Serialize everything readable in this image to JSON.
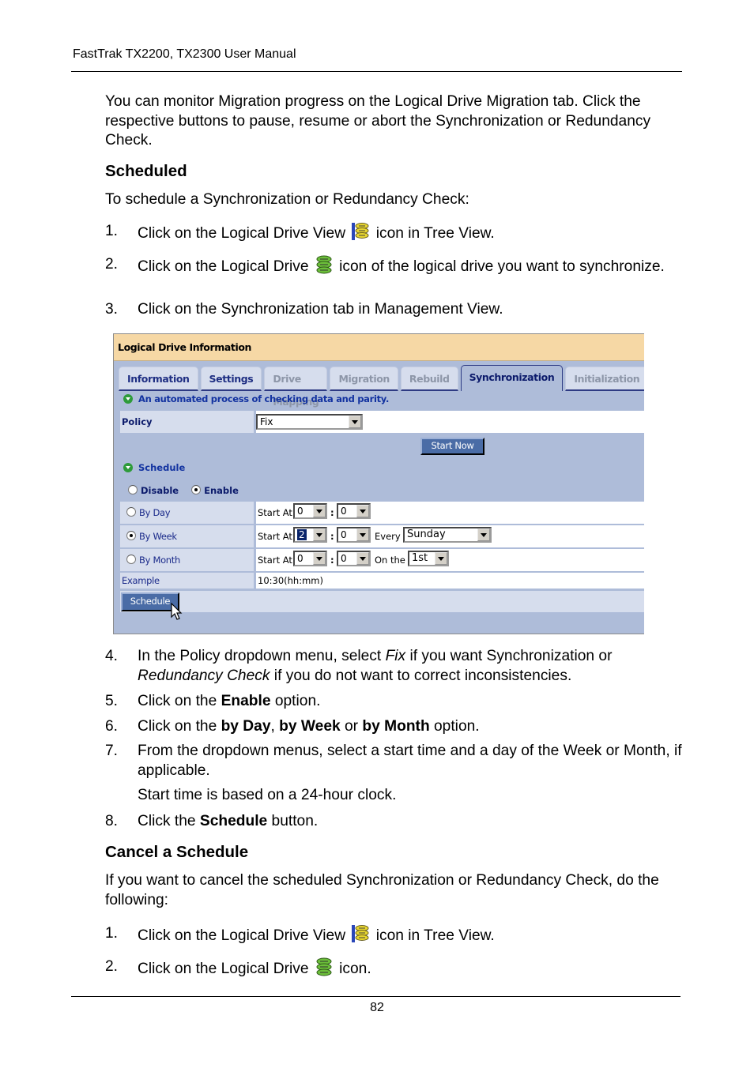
{
  "header": {
    "title": "FastTrak TX2200, TX2300 User Manual"
  },
  "intro": "You can monitor Migration progress on the Logical Drive Migration tab. Click the respective buttons to pause, resume or abort the Synchronization or Redundancy Check.",
  "scheduled": {
    "heading": "Scheduled",
    "lead": "To schedule a Synchronization or Redundancy Check:",
    "steps": [
      {
        "num": "1.",
        "before": "Click on the Logical Drive View",
        "icon": "logical-drive-view-icon",
        "after": "icon in Tree View."
      },
      {
        "num": "2.",
        "before": "Click on the Logical Drive",
        "icon": "logical-drive-icon",
        "after": "icon of the logical drive you want to synchronize."
      },
      {
        "num": "3.",
        "text": "Click on the Synchronization tab in Management View."
      }
    ],
    "steps_after": [
      {
        "num": "4.",
        "p1": "In the Policy dropdown menu, select ",
        "i1": "Fix",
        "p2": " if you want Synchronization or ",
        "i2": "Redundancy Check",
        "p3": " if you do not want to correct inconsistencies."
      },
      {
        "num": "5.",
        "p1": "Click on the ",
        "b1": "Enable",
        "p2": " option."
      },
      {
        "num": "6.",
        "p1": "Click on the ",
        "b1": "by Day",
        "p2": ", ",
        "b2": "by Week",
        "p3": " or ",
        "b3": "by Month",
        "p4": " option."
      },
      {
        "num": "7.",
        "text": "From the dropdown menus, select a start time and a day of the Week or Month, if applicable.",
        "note": "Start time is based on a 24-hour clock."
      },
      {
        "num": "8.",
        "p1": "Click the ",
        "b1": "Schedule",
        "p2": " button."
      }
    ]
  },
  "cancel": {
    "heading": "Cancel a Schedule",
    "lead": "If you want to cancel the scheduled Synchronization or Redundancy Check, do the following:",
    "steps": [
      {
        "num": "1.",
        "before": "Click on the Logical Drive View",
        "icon": "logical-drive-view-icon",
        "after": "icon in Tree View."
      },
      {
        "num": "2.",
        "before": "Click on the Logical Drive",
        "icon": "logical-drive-icon",
        "after": "icon."
      }
    ]
  },
  "screenshot": {
    "panel_title": "Logical Drive Information",
    "tabs": [
      {
        "label": "Information",
        "state": "enabled"
      },
      {
        "label": "Settings",
        "state": "enabled"
      },
      {
        "label": "Drive Mapping",
        "state": "disabled"
      },
      {
        "label": "Migration",
        "state": "disabled"
      },
      {
        "label": "Rebuild",
        "state": "disabled"
      },
      {
        "label": "Synchronization",
        "state": "active"
      },
      {
        "label": "Initialization",
        "state": "disabled"
      }
    ],
    "description": "An automated process of checking data and parity.",
    "policy_label": "Policy",
    "policy_value": "Fix",
    "start_now_label": "Start Now",
    "schedule_heading": "Schedule",
    "disable_label": "Disable",
    "enable_label": "Enable",
    "schedule_enabled": true,
    "by_day": {
      "label": "By Day",
      "start_at_label": "Start At",
      "hour": "0",
      "minute": "0",
      "selected": false
    },
    "by_week": {
      "label": "By Week",
      "start_at_label": "Start At",
      "hour": "2",
      "minute": "0",
      "every_label": "Every",
      "day": "Sunday",
      "selected": true
    },
    "by_month": {
      "label": "By Month",
      "start_at_label": "Start At",
      "hour": "0",
      "minute": "0",
      "on_the_label": "On the",
      "date": "1st",
      "selected": false
    },
    "time_sep": ":",
    "example_label": "Example",
    "example_value": "10:30(hh:mm)",
    "schedule_button": "Schedule"
  },
  "footer": {
    "page": "82"
  }
}
